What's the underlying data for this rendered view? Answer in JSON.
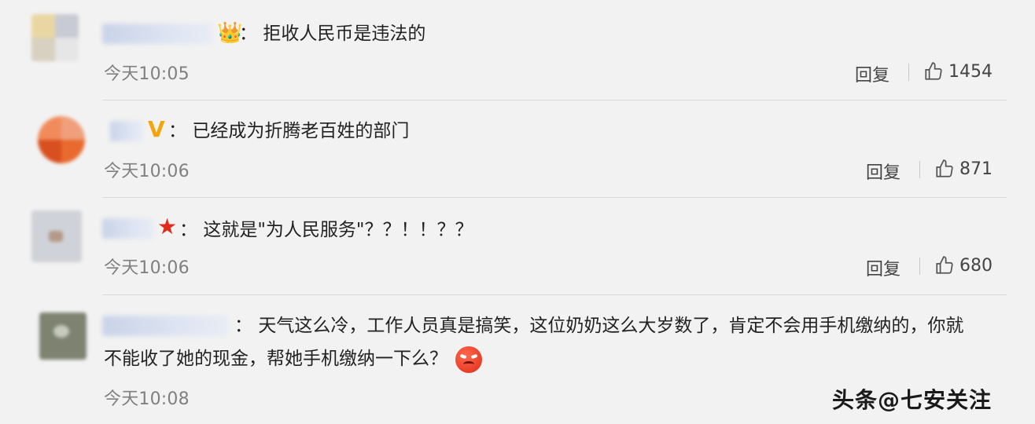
{
  "comments": [
    {
      "badge_icon": "crown-icon",
      "colon": "：",
      "text": "拒收人民币是违法的",
      "time": "今天10:05",
      "reply_label": "回复",
      "likes": "1454"
    },
    {
      "badge_icon": "verified-v-icon",
      "colon": "：",
      "text": "已经成为折腾老百姓的部门",
      "time": "今天10:06",
      "reply_label": "回复",
      "likes": "871"
    },
    {
      "badge_icon": "red-star-icon",
      "colon": "：",
      "text": "这就是\"为人民服务\"？？！！？？",
      "time": "今天10:06",
      "reply_label": "回复",
      "likes": "680"
    },
    {
      "badge_icon": "",
      "colon": "：",
      "text_line1": "天气这么冷，工作人员真是搞笑，这位奶奶这么大岁数了，肯定不会用手机缴纳的，你就",
      "text_line2": "不能收了她的现金，帮她手机缴纳一下么？",
      "emoji_icon": "angry-face-emoji",
      "time": "今天10:08"
    }
  ],
  "watermark": "头条@七安关注",
  "colors": {
    "background": "#f2f2f2",
    "divider": "#d9d9d9",
    "time": "#808080"
  }
}
